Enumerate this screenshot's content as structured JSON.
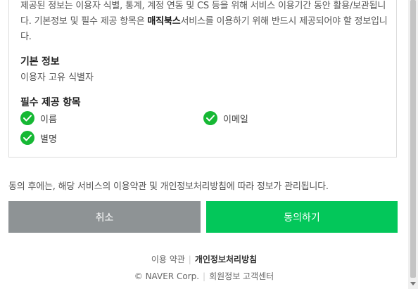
{
  "consent": {
    "intro_part1": "제공된 정보는 이용자 식별, 통계, 계정 연동 및 CS 등을 위해 서비스 이용기간 동안 활용/보관됩니다. 기본정보 및 필수 제공 항목은 ",
    "service_name": "매직북스",
    "intro_part2": "서비스를 이용하기 위해 반드시 제공되어야 할 정보입니다.",
    "basic_title": "기본 정보",
    "basic_text": "이용자 고유 식별자",
    "required_title": "필수 제공 항목",
    "items": [
      "이름",
      "이메일",
      "별명"
    ],
    "check_color": "#16b834"
  },
  "notice": "동의 후에는, 해당 서비스의 이용약관 및 개인정보처리방침에 따라 정보가 관리됩니다.",
  "buttons": {
    "cancel": "취소",
    "agree": "동의하기",
    "cancel_color": "#8e9395",
    "agree_color": "#03c75a"
  },
  "footer": {
    "terms": "이용 약관",
    "privacy": "개인정보처리방침",
    "copyright": "© NAVER Corp.",
    "help": "회원정보 고객센터"
  }
}
